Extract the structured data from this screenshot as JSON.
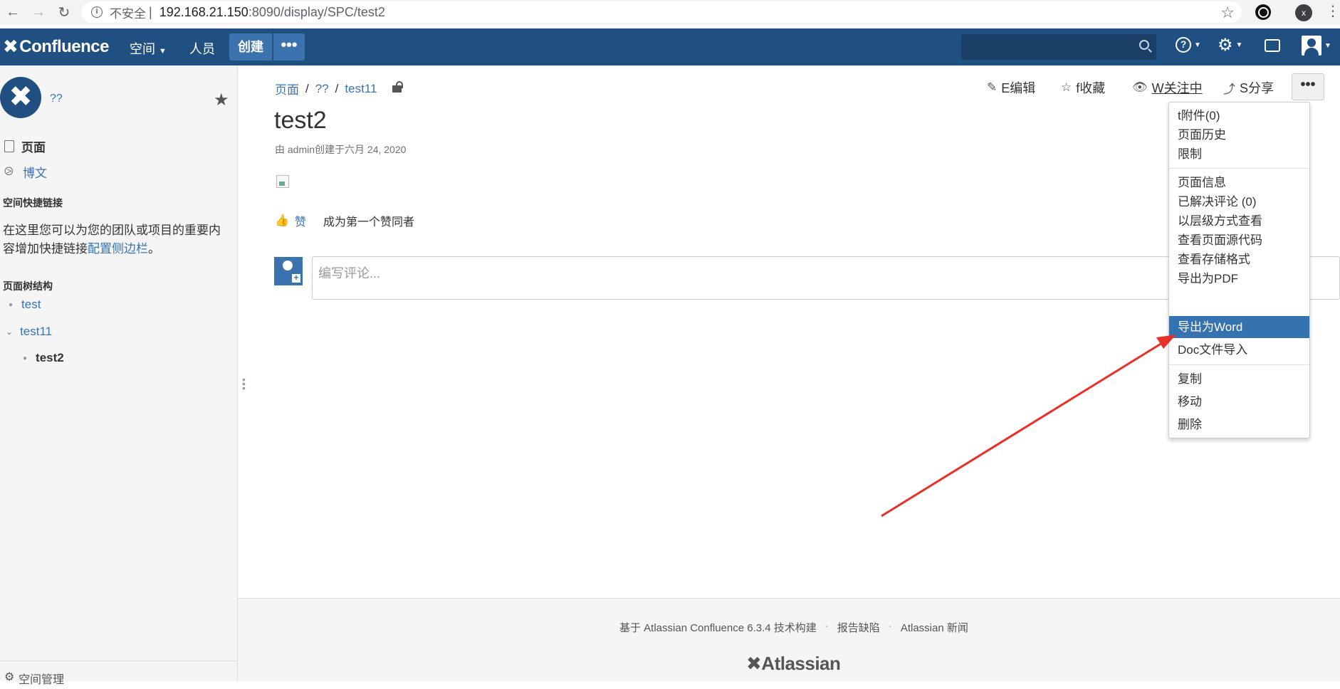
{
  "browser": {
    "insecure_label": "不安全",
    "url_host": "192.168.21.150",
    "url_path": ":8090/display/SPC/test2",
    "ext_badge": "x"
  },
  "header": {
    "logo": "Confluence",
    "spaces": "空间",
    "people": "人员",
    "create": "创建",
    "more": "•••"
  },
  "sidebar": {
    "space_name": "??",
    "pages": "页面",
    "blog": "博文",
    "quicklinks_title": "空间快捷链接",
    "quicklinks_text": "在这里您可以为您的团队或项目的重要内容增加快捷链接",
    "quicklinks_link": "配置侧边栏",
    "quicklinks_end": "。",
    "tree_title": "页面树结构",
    "tree": [
      "test",
      "test11",
      "test2"
    ],
    "bottom_label": "空间管理"
  },
  "breadcrumb": [
    "页面",
    "??",
    "test11"
  ],
  "actions": {
    "edit": "E编辑",
    "favourite": "f收藏",
    "watch": "W关注中",
    "share": "S分享"
  },
  "page": {
    "title": "test2",
    "byline": "由 admin创建于六月 24, 2020",
    "like": "赞",
    "like_hint": "成为第一个赞同者",
    "comment_placeholder": "编写评论..."
  },
  "menu": {
    "group1": [
      "t附件(0)",
      "页面历史",
      "限制"
    ],
    "group2": [
      "页面信息",
      "已解决评论 (0)",
      "以层级方式查看",
      "查看页面源代码",
      "查看存储格式",
      "导出为PDF",
      "导出为Word",
      "Doc文件导入"
    ],
    "group3": [
      "复制",
      "移动",
      "删除"
    ],
    "selected": "导出为Word"
  },
  "footer": {
    "built_with": "基于 Atlassian Confluence 6.3.4 技术构建",
    "report_bug": "报告缺陷",
    "news": "Atlassian 新闻",
    "logo": "Atlassian"
  },
  "colors": {
    "header_bg": "#205081",
    "link": "#3b73af",
    "menu_selected": "#3572b0",
    "annotation_arrow": "#e8302a"
  }
}
